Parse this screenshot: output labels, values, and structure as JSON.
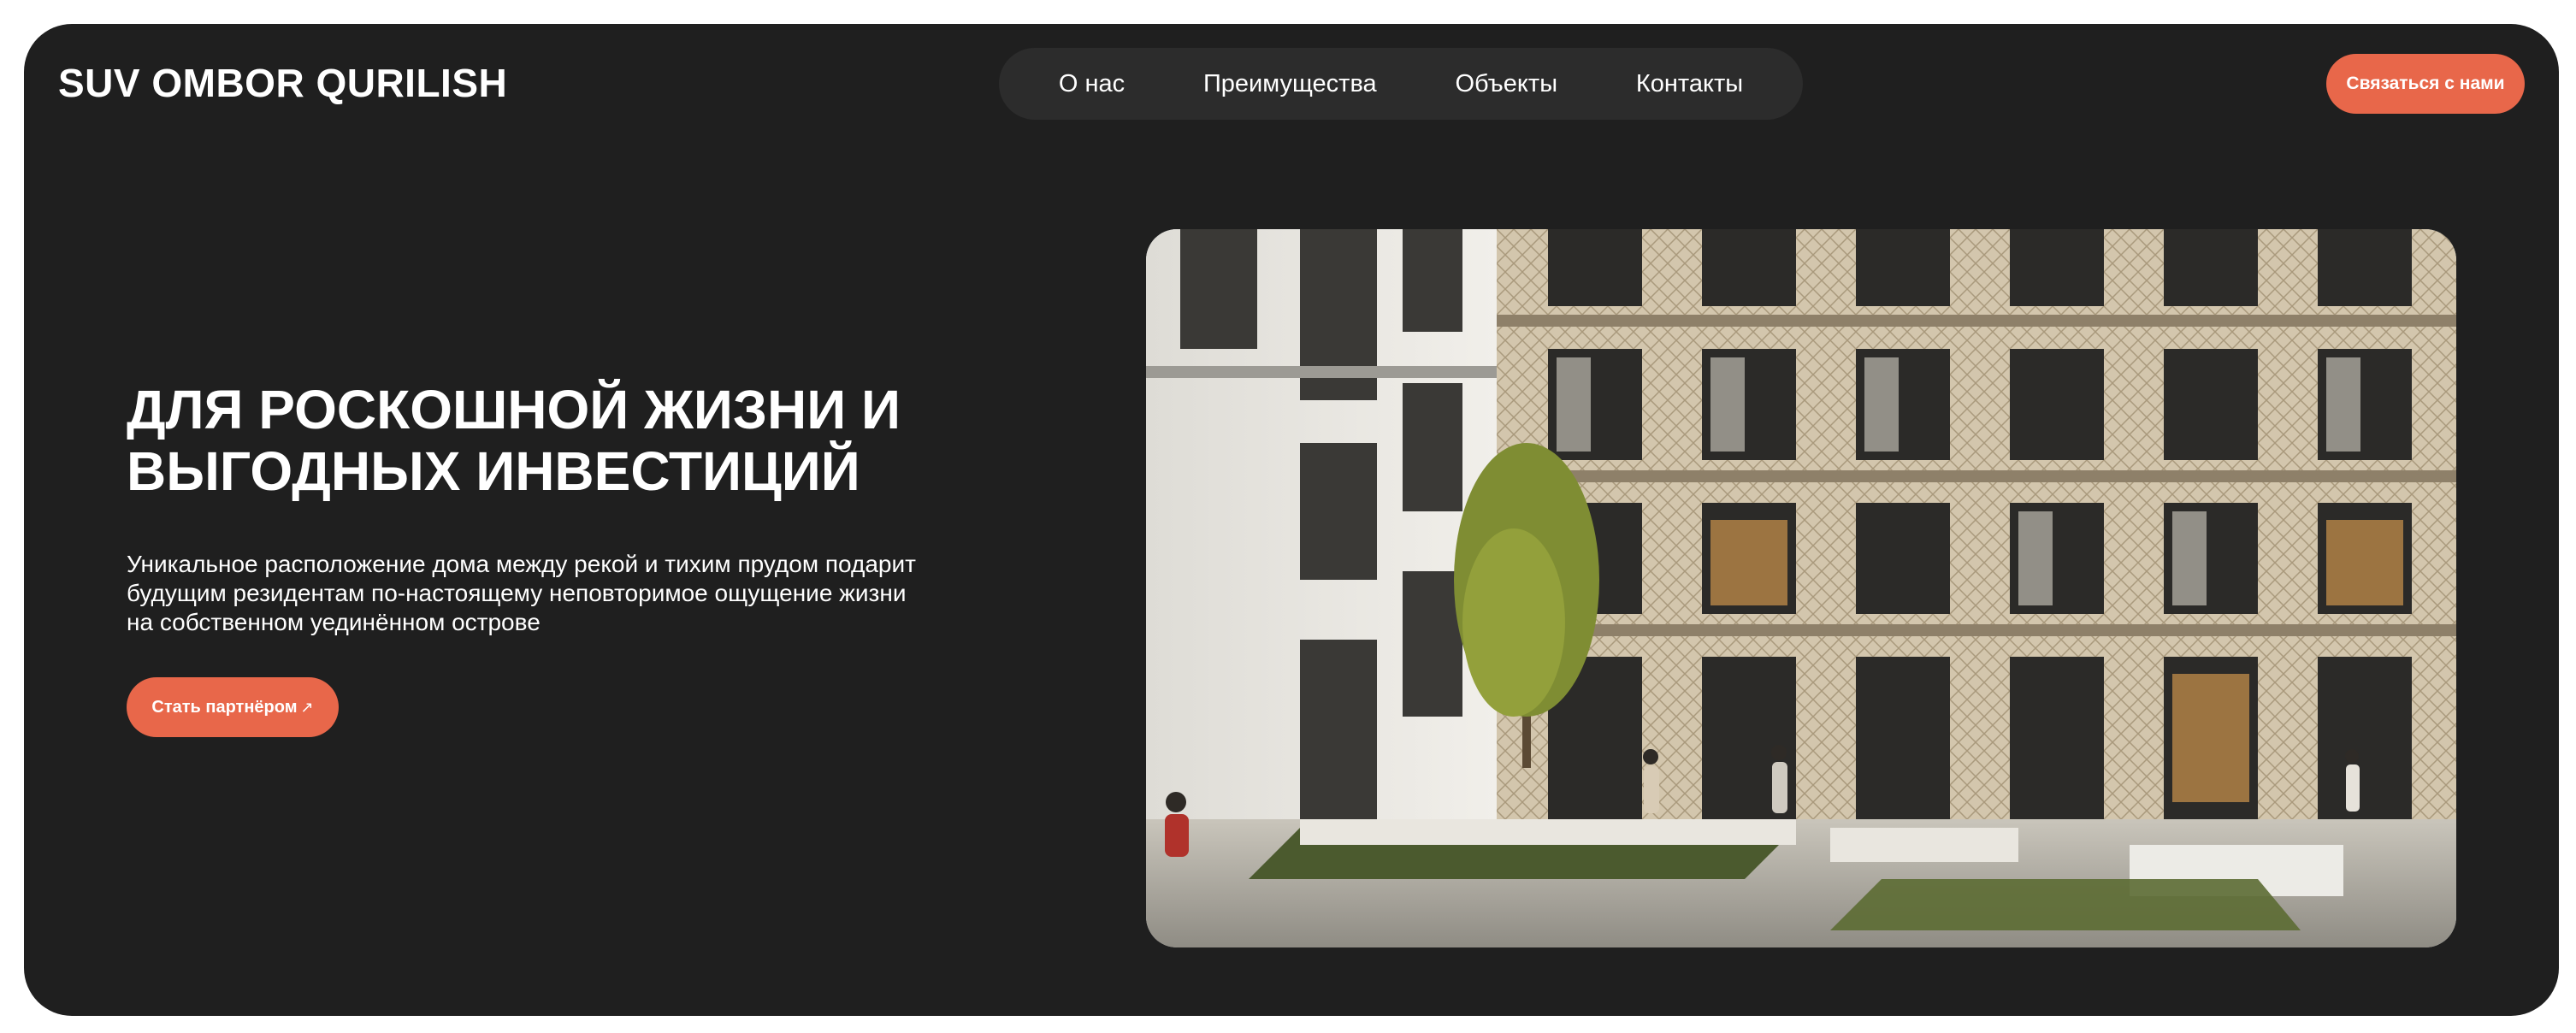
{
  "header": {
    "logo": "SUV OMBOR QURILISH",
    "nav": [
      "О нас",
      "Преимущества",
      "Объекты",
      "Контакты"
    ],
    "cta_label": "Связаться с нами"
  },
  "hero": {
    "title_line1": "ДЛЯ РОСКОШНОЙ ЖИЗНИ И",
    "title_line2": "ВЫГОДНЫХ ИНВЕСТИЦИЙ",
    "description_line1": "Уникальное расположение дома между рекой и тихим прудом подарит",
    "description_line2": "будущим резидентам по-настоящему неповторимое ощущение жизни",
    "description_line3": "на собственном уединённом острове",
    "button_label": "Стать партнёром",
    "button_icon": "arrow-up-right-icon",
    "image_subject": "building-facade-photo"
  },
  "colors": {
    "background": "#1f1f1f",
    "nav_background": "#2c2c2c",
    "accent": "#e8674a",
    "text": "#ffffff"
  }
}
